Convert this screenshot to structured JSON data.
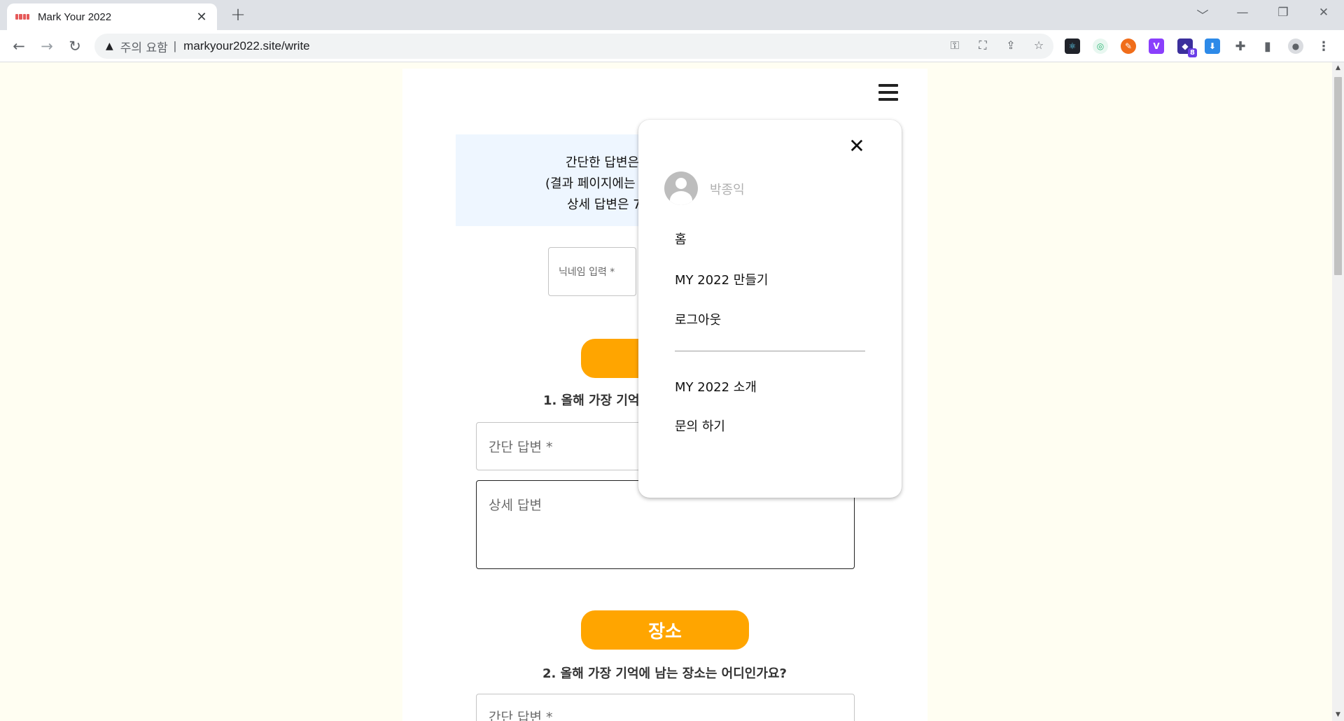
{
  "browser": {
    "tab_title": "Mark Your 2022",
    "tab_close": "✕",
    "new_tab": "+",
    "window_controls": [
      "﹀",
      "—",
      "❐",
      "✕"
    ],
    "back": "←",
    "forward": "→",
    "reload": "↻",
    "security_warning": "주의 요함",
    "url_separator": "|",
    "url": "markyour2022.site/write",
    "extension_badge": "8"
  },
  "page": {
    "info_lines": [
      "간단한 답변은",
      "(결과 페이지에는",
      "상세 답변은 7"
    ],
    "nickname_placeholder": "닉네임 입력 *",
    "section1": {
      "question": "1. 올해 가장 기억에",
      "short_placeholder": "간단 답변 *",
      "detail_placeholder": "상세 답변"
    },
    "section2": {
      "button": "장소",
      "question": "2. 올해 가장 기억에 남는 장소는 어디인가요?",
      "short_placeholder": "간단 답변 *"
    }
  },
  "menu": {
    "close": "✕",
    "username": "박종익",
    "items": [
      "홈",
      "MY 2022 만들기",
      "로그아웃"
    ],
    "secondary_items": [
      "MY 2022 소개",
      "문의 하기"
    ]
  },
  "colors": {
    "accent": "#ffa500",
    "page_background": "#fffef2",
    "info_background": "#eef6ff"
  }
}
